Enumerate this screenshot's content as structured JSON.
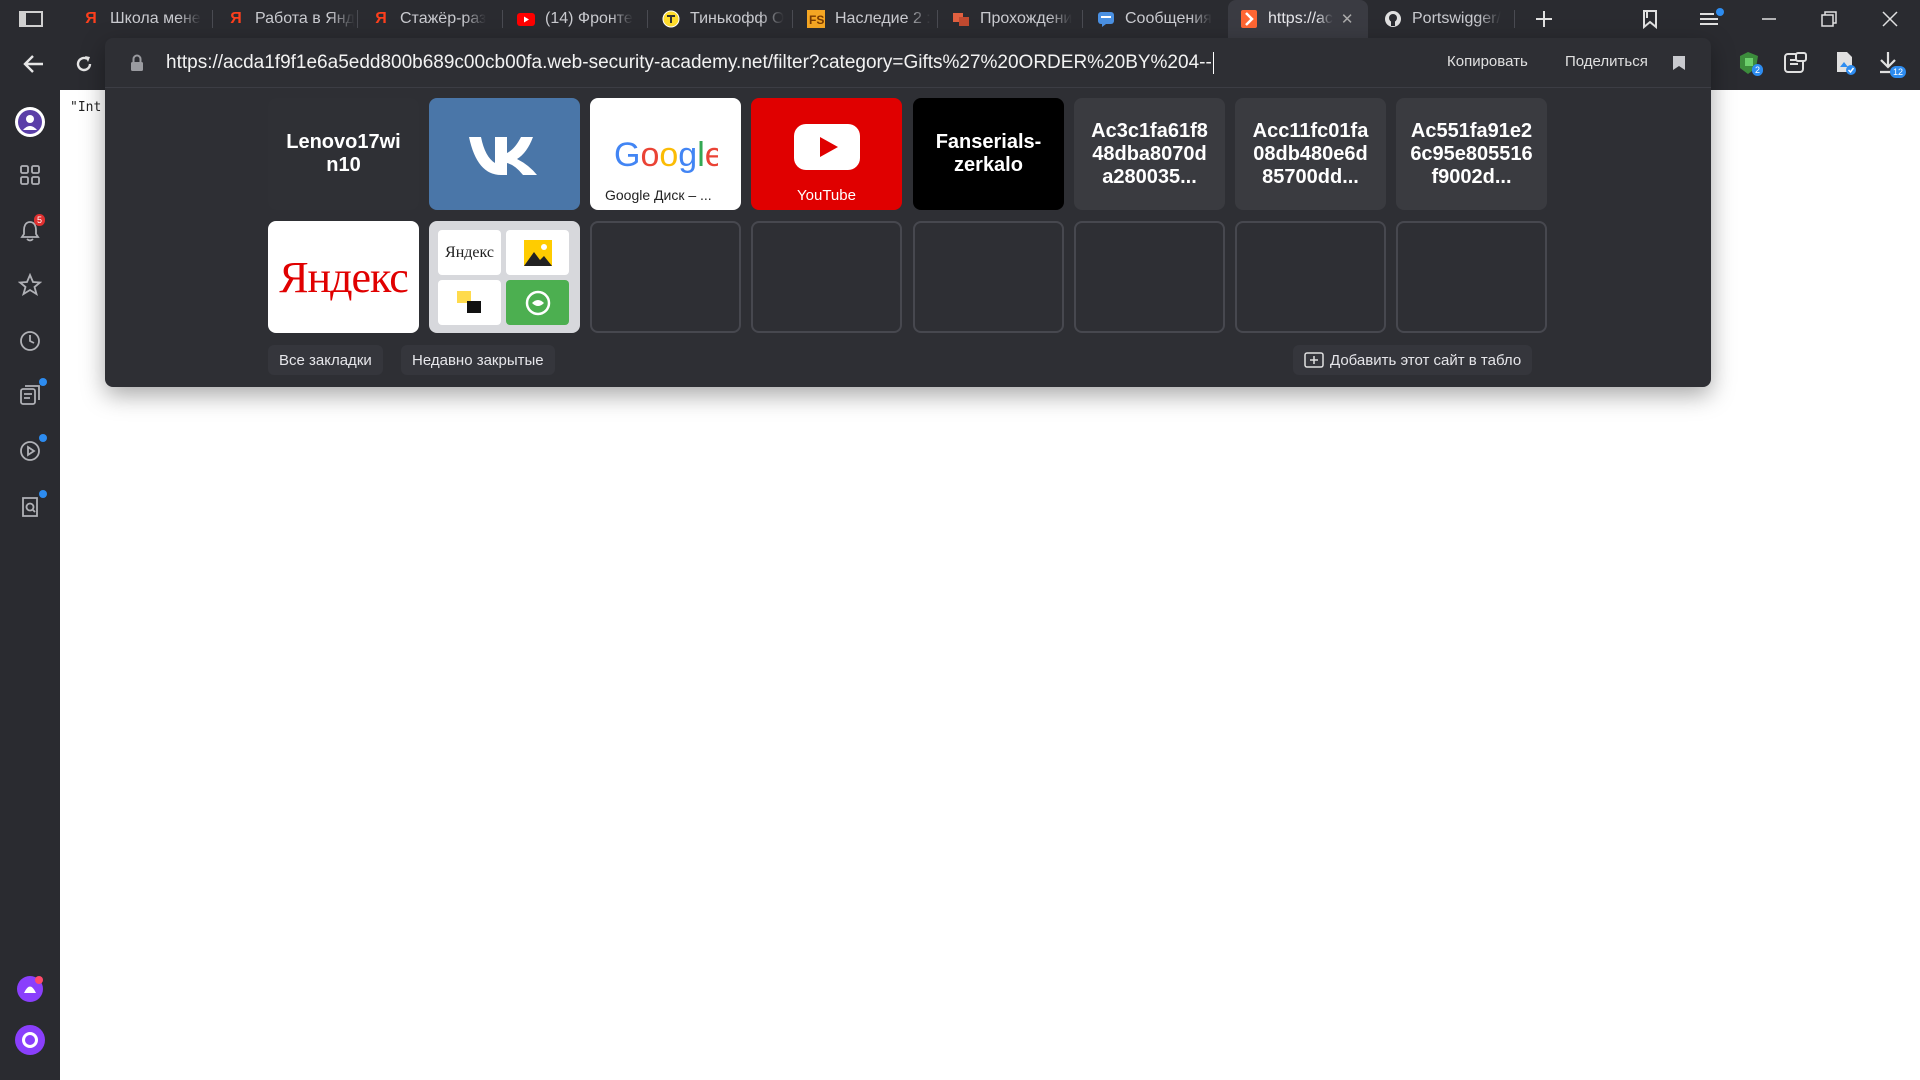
{
  "tabs": [
    {
      "label": "Школа мене",
      "icon": "yandex-icon",
      "color": "#fc3f1d"
    },
    {
      "label": "Работа в Янд",
      "icon": "yandex-icon",
      "color": "#fc3f1d"
    },
    {
      "label": "Стажёр-раз",
      "icon": "yandex-icon",
      "color": "#fc3f1d"
    },
    {
      "label": "(14) Фронте",
      "icon": "youtube-icon",
      "color": "#ff0000"
    },
    {
      "label": "Тинькофф О",
      "icon": "tinkoff-icon",
      "color": "#ffdd2d"
    },
    {
      "label": "Наследие 2 :",
      "icon": "fs-icon",
      "color": "#f5a623"
    },
    {
      "label": "Прохождени",
      "icon": "game-icon",
      "color": "#e06040"
    },
    {
      "label": "Сообщения",
      "icon": "messages-icon",
      "color": "#4a90e2"
    },
    {
      "label": "https://ac",
      "icon": "portswigger-icon",
      "color": "#ff6633"
    },
    {
      "label": "Portswigger/",
      "icon": "github-icon",
      "color": "#ffffff"
    }
  ],
  "address": {
    "url": "https://acda1f9f1e6a5edd800b689c00cb00fa.web-security-academy.net/filter?category=Gifts%27%20ORDER%20BY%204--",
    "copy_label": "Копировать",
    "share_label": "Поделиться"
  },
  "tiles": [
    {
      "label": "Lenovo17wi n10",
      "bg": "#2f3035"
    },
    {
      "label": "",
      "caption": "",
      "kind": "vk",
      "bg": "#4a76a8"
    },
    {
      "label": "",
      "caption": "Google Диск – ...",
      "kind": "google",
      "bg": "#ffffff"
    },
    {
      "label": "",
      "caption": "YouTube",
      "kind": "youtube",
      "bg": "#e00000"
    },
    {
      "label": "Fanserials-zerkalo",
      "bg": "#000000"
    },
    {
      "label": "Ac3c1fa61f848dba8070da280035...",
      "bg": "#3a3b40"
    },
    {
      "label": "Acc11fc01fa08db480e6d85700dd...",
      "bg": "#3a3b40"
    },
    {
      "label": "Ac551fa91e26c95e805516f9002d...",
      "bg": "#3a3b40"
    }
  ],
  "tiles_row2": {
    "yandex_label": "Яндекс",
    "folder_mini_label": "Яндекс"
  },
  "bottom": {
    "all_bookmarks": "Все закладки",
    "recently_closed": "Недавно закрытые",
    "add_site": "Добавить этот сайт в табло"
  },
  "page": {
    "text": "\"Int"
  },
  "sidebar": {
    "notifications_badge": "5"
  },
  "toolbar": {
    "downloads_badge": "12",
    "ext_badge": "2"
  }
}
